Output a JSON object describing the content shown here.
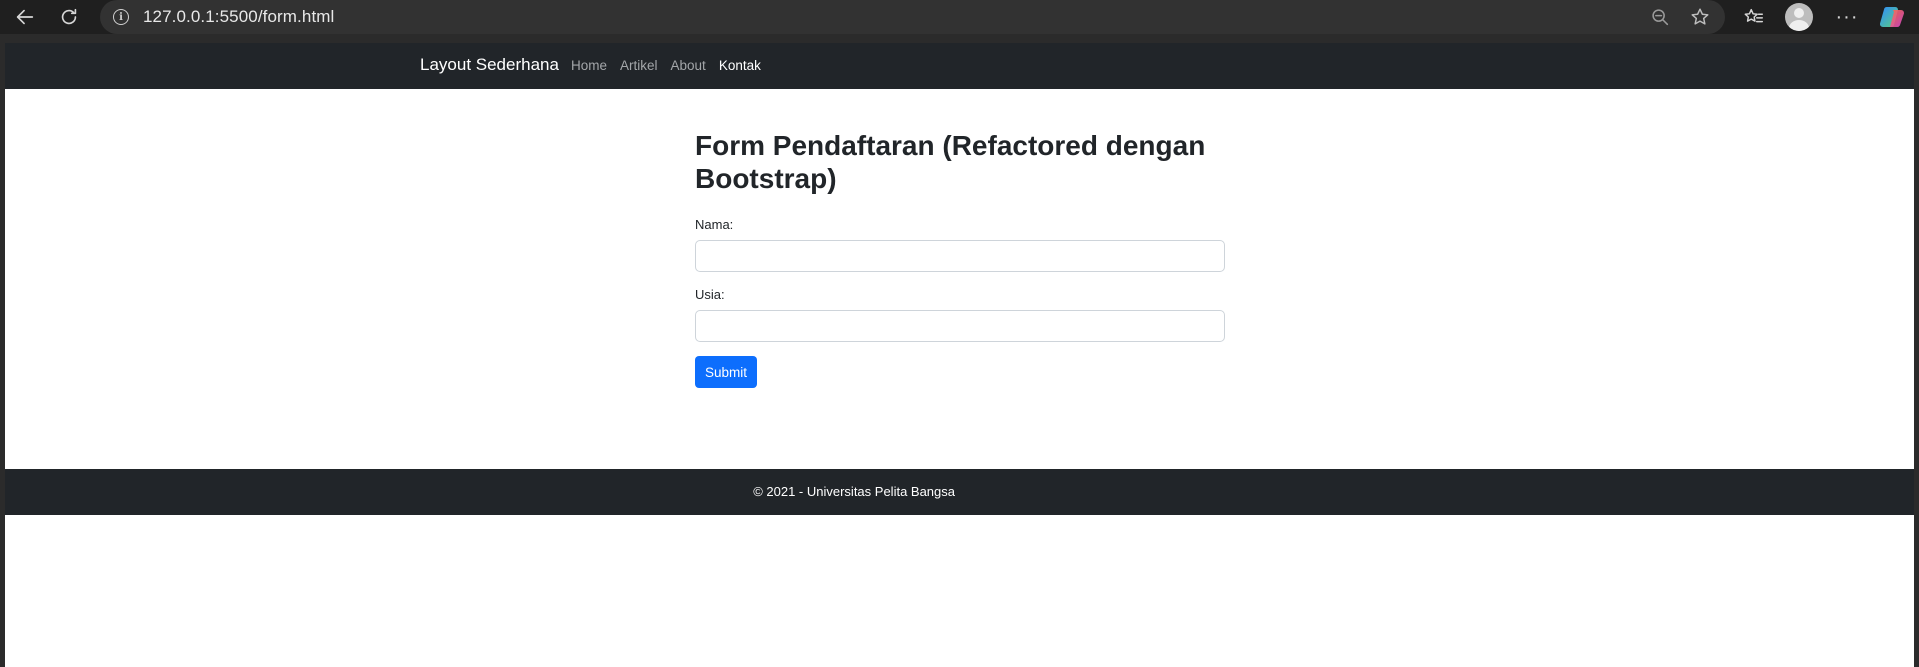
{
  "browser": {
    "url": "127.0.0.1:5500/form.html",
    "icons": [
      "back-arrow-icon",
      "reload-icon",
      "info-icon",
      "zoom-out-icon",
      "star-icon",
      "favorites-icon",
      "profile-avatar-icon",
      "more-icon",
      "copilot-icon"
    ]
  },
  "navbar": {
    "brand": "Layout Sederhana",
    "links": [
      {
        "label": "Home",
        "active": false
      },
      {
        "label": "Artikel",
        "active": false
      },
      {
        "label": "About",
        "active": false
      },
      {
        "label": "Kontak",
        "active": true
      }
    ]
  },
  "form": {
    "title": "Form Pendaftaran (Refactored dengan Bootstrap)",
    "fields": [
      {
        "label": "Nama:",
        "value": ""
      },
      {
        "label": "Usia:",
        "value": ""
      }
    ],
    "submit_label": "Submit"
  },
  "footer": {
    "text": "© 2021 - Universitas Pelita Bangsa"
  },
  "colors": {
    "navbar_bg": "#212529",
    "primary": "#0d6efd",
    "browser_chrome": "#1f1f1f"
  }
}
